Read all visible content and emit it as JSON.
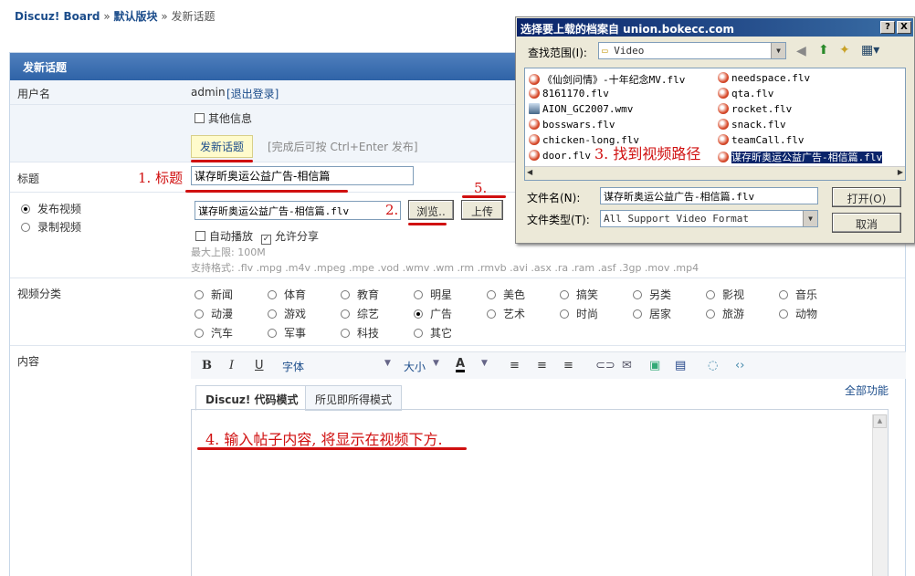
{
  "breadcrumb": {
    "site": "Discuz! Board",
    "sep1": "»",
    "forum": "默认版块",
    "sep2": "»",
    "page": "发新话题"
  },
  "panel_title": "发新话题",
  "user": {
    "label": "用户名",
    "name": "admin",
    "logout": "[退出登录]"
  },
  "other_info": "其他信息",
  "post_button": "发新话题",
  "post_hint": "[完成后可按 Ctrl+Enter 发布]",
  "title_row": {
    "label": "标题",
    "value": "谋存昕奥运公益广告-相信篇"
  },
  "video": {
    "opt_publish": "发布视频",
    "opt_record": "录制视频",
    "file_value": "谋存昕奥运公益广告-相信篇.flv",
    "browse": "浏览..",
    "upload": "上传",
    "autoplay": "自动播放",
    "share": "允许分享",
    "max": "最大上限: 100M",
    "formats": "支持格式: .flv .mpg .m4v .mpeg .mpe .vod .wmv .wm .rm .rmvb .avi .asx .ra .ram .asf .3gp .mov .mp4"
  },
  "category": {
    "label": "视频分类",
    "items": [
      "新闻",
      "体育",
      "教育",
      "明星",
      "美色",
      "搞笑",
      "另类",
      "影视",
      "音乐",
      "动漫",
      "游戏",
      "综艺",
      "广告",
      "艺术",
      "时尚",
      "居家",
      "旅游",
      "动物",
      "汽车",
      "军事",
      "科技",
      "其它"
    ],
    "selected": "广告"
  },
  "content": {
    "label": "内容",
    "font": "字体",
    "size": "大小",
    "all_features": "全部功能",
    "tab_code": "Discuz! 代码模式",
    "tab_wysiwyg": "所见即所得模式"
  },
  "annotations": {
    "a1": "1. 标题",
    "a2": "2.",
    "a3": "3. 找到视频路径",
    "a4": "4. 输入帖子内容, 将显示在视频下方.",
    "a5": "5."
  },
  "dialog": {
    "title": "选择要上载的档案自 union.bokecc.com",
    "lookin_label": "查找范围(I):",
    "lookin_value": "Video",
    "files_left": [
      "《仙剑问情》-十年纪念MV.flv",
      "8161170.flv",
      "AION_GC2007.wmv",
      "bosswars.flv",
      "chicken-long.flv",
      "door.flv"
    ],
    "files_right": [
      "needspace.flv",
      "qta.flv",
      "rocket.flv",
      "snack.flv",
      "teamCall.flv",
      "谋存昕奥运公益广告-相信篇.flv"
    ],
    "filename_label": "文件名(N):",
    "filename_value": "谋存昕奥运公益广告-相信篇.flv",
    "filetype_label": "文件类型(T):",
    "filetype_value": "All Support Video Format",
    "open": "打开(O)",
    "cancel": "取消",
    "help_btn": "?",
    "close_btn": "X"
  },
  "colors": {
    "header": "#2f63a7",
    "annotation": "#d01010",
    "link": "#1c4d8b"
  }
}
